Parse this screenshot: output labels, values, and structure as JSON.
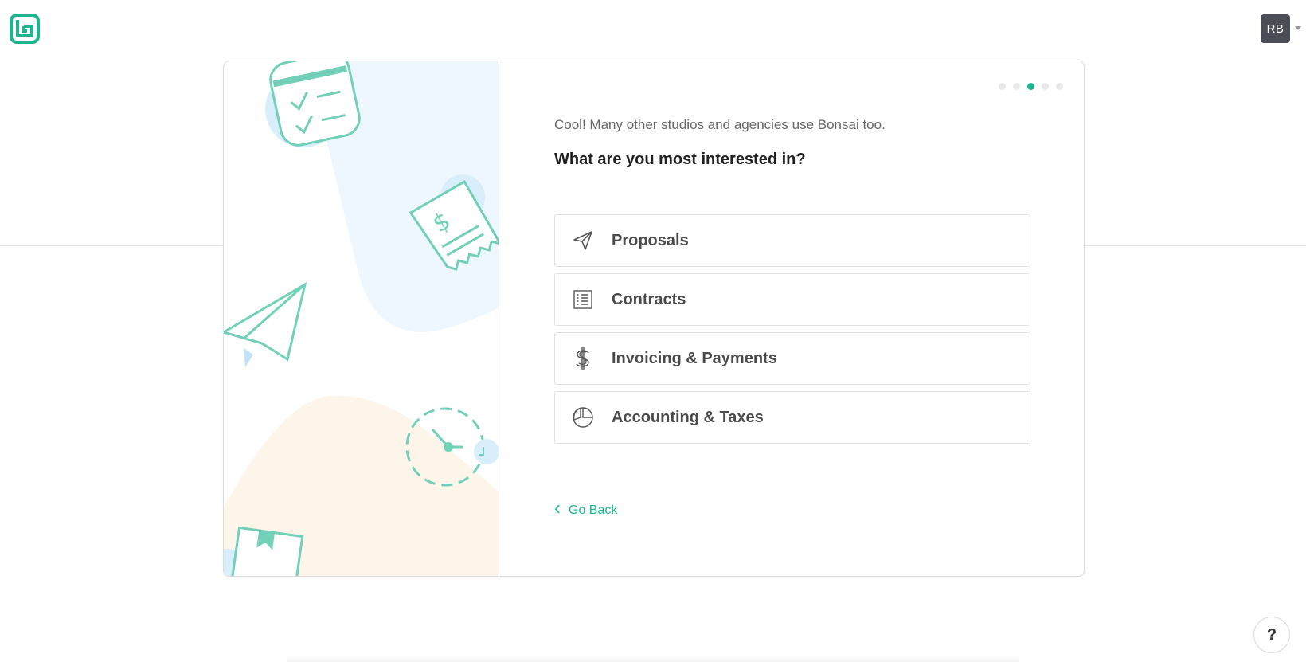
{
  "header": {
    "logo_icon": "bonsai-logo-icon",
    "avatar_initials": "RB",
    "brand_color": "#1cb590"
  },
  "step": {
    "current": 3,
    "total": 5
  },
  "panel": {
    "subtitle": "Cool!  Many other studios and agencies use Bonsai too.",
    "question": "What are you most interested in?",
    "options": [
      {
        "label": "Proposals",
        "icon": "paper-plane-icon"
      },
      {
        "label": "Contracts",
        "icon": "list-document-icon"
      },
      {
        "label": "Invoicing & Payments",
        "icon": "dollar-icon"
      },
      {
        "label": "Accounting & Taxes",
        "icon": "pie-chart-icon"
      }
    ],
    "go_back_label": "Go Back"
  },
  "help": {
    "label": "?"
  }
}
